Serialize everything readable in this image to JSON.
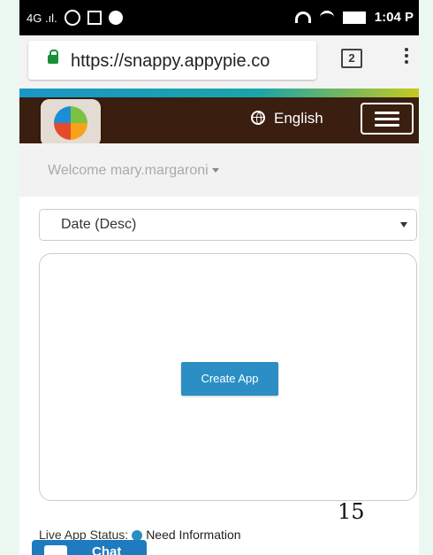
{
  "statusbar": {
    "network": "4G .ıl.",
    "time": "1:04 P"
  },
  "browser": {
    "url": "https://snappy.appypie.co",
    "tab_count": "2"
  },
  "header": {
    "language": "English"
  },
  "welcome": {
    "text": "Welcome mary.margaroni"
  },
  "sort": {
    "selected": "Date (Desc)"
  },
  "card": {
    "create_label": "Create App"
  },
  "page_number": "15",
  "live_status": {
    "label": "Live App Status:",
    "value": "Need Information"
  },
  "chat": {
    "label": "Chat"
  },
  "colors": {
    "header_bg": "#3a1e10",
    "accent": "#2b8fc6",
    "secure": "#1a8f3a"
  }
}
